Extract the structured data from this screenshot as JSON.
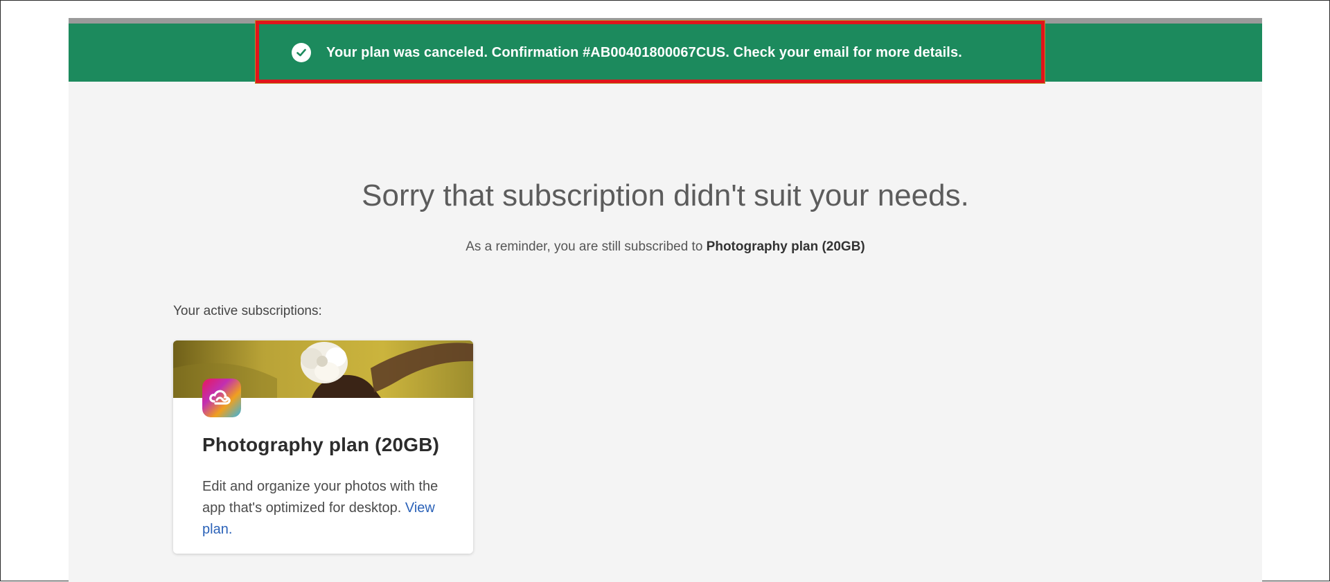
{
  "notification": {
    "message": "Your plan was canceled. Confirmation #AB00401800067CUS. Check your email for more details.",
    "icon": "check-circle-icon",
    "color": "#1c8a5d"
  },
  "main": {
    "headline": "Sorry that subscription didn't suit your needs.",
    "reminder_prefix": "As a reminder, you are still subscribed to ",
    "reminder_plan": "Photography plan (20GB)",
    "section_label": "Your active subscriptions:"
  },
  "subscription_card": {
    "icon": "creative-cloud-icon",
    "title": "Photography plan (20GB)",
    "description": "Edit and organize your photos with the app that's optimized for desktop. ",
    "link_text": "View plan."
  },
  "colors": {
    "accent_link": "#2b62b8",
    "highlight_border": "#e1141b"
  }
}
